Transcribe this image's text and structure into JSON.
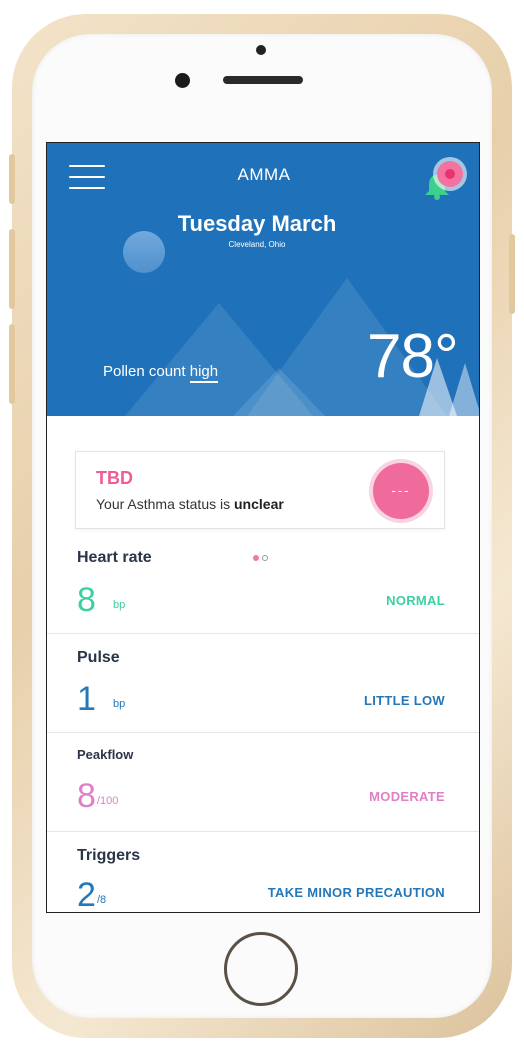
{
  "app": {
    "title": "AMMA"
  },
  "header": {
    "date": "Tuesday March",
    "location": "Cleveland, Ohio",
    "pollen_prefix": "Pollen count",
    "pollen_level": "high",
    "temperature": "78°"
  },
  "status_card": {
    "title": "TBD",
    "text_prefix": "Your Asthma status is",
    "text_status": "unclear",
    "indicator": "---"
  },
  "pager": {
    "current": 1,
    "total": 2
  },
  "metrics": [
    {
      "label": "Heart rate",
      "value": "8",
      "unit": "bp",
      "status": "NORMAL",
      "color": "#3ccfa3"
    },
    {
      "label": "Pulse",
      "value": "1",
      "unit": "bp",
      "status": "LITTLE LOW",
      "color": "#2478b9"
    },
    {
      "label": "Peakflow",
      "value": "8",
      "unit": "/100",
      "status": "MODERATE",
      "color": "#e07fc6"
    },
    {
      "label": "Triggers",
      "value": "2",
      "unit": "/8",
      "status": "TAKE MINOR PRECAUTION",
      "color": "#2478b9"
    }
  ],
  "colors": {
    "header_bg": "#1f72ba",
    "accent_pink": "#ef5b94",
    "notification": "#f472a0",
    "bell": "#3ccf8e"
  },
  "icons": {
    "menu": "hamburger-icon",
    "notifications": "bell-icon",
    "sun": "sun-icon"
  }
}
